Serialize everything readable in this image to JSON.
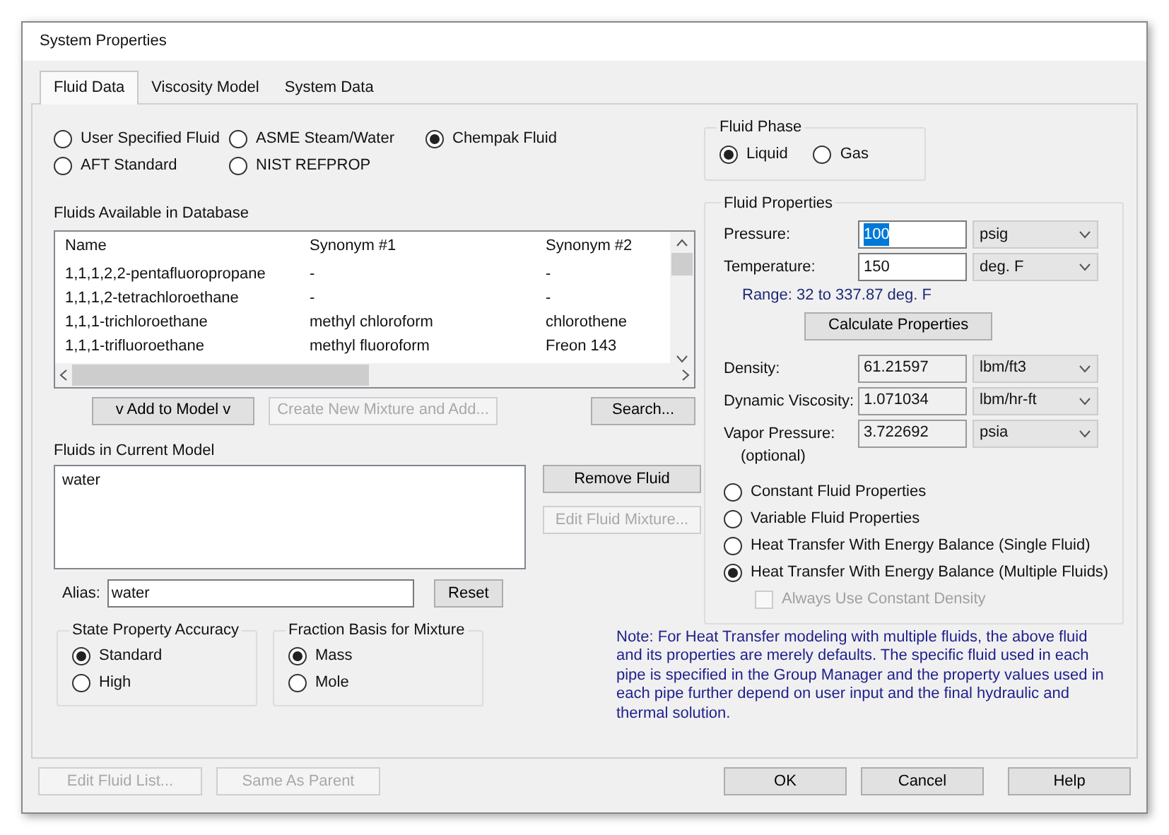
{
  "window": {
    "title": "System Properties"
  },
  "tabs": [
    {
      "label": "Fluid Data",
      "selected": true
    },
    {
      "label": "Viscosity Model",
      "selected": false
    },
    {
      "label": "System Data",
      "selected": false
    }
  ],
  "fluid_source": [
    {
      "label": "User Specified Fluid",
      "selected": false
    },
    {
      "label": "ASME Steam/Water",
      "selected": false
    },
    {
      "label": "Chempak Fluid",
      "selected": true
    },
    {
      "label": "AFT Standard",
      "selected": false
    },
    {
      "label": "NIST REFPROP",
      "selected": false
    }
  ],
  "database": {
    "label": "Fluids Available in Database",
    "columns": [
      "Name",
      "Synonym #1",
      "Synonym #2"
    ],
    "rows": [
      [
        "1,1,1,2,2-pentafluoropropane",
        "-",
        "-"
      ],
      [
        "1,1,1,2-tetrachloroethane",
        "-",
        "-"
      ],
      [
        "1,1,1-trichloroethane",
        "methyl chloroform",
        "chlorothene"
      ],
      [
        "1,1,1-trifluoroethane",
        "methyl fluoroform",
        "Freon 143"
      ]
    ]
  },
  "database_buttons": [
    {
      "label": "v  Add to Model  v",
      "disabled": false
    },
    {
      "label": "Create New Mixture and Add...",
      "disabled": true
    },
    {
      "label": "Search...",
      "disabled": false
    }
  ],
  "current_model": {
    "label": "Fluids in Current Model",
    "items": [
      "water"
    ]
  },
  "model_buttons": [
    {
      "label": "Remove Fluid",
      "disabled": false
    },
    {
      "label": "Edit Fluid Mixture...",
      "disabled": true
    }
  ],
  "alias": {
    "label": "Alias:",
    "value": "water",
    "button": "Reset"
  },
  "option_groups": [
    {
      "title": "State Property Accuracy",
      "options": [
        {
          "label": "Standard",
          "selected": true
        },
        {
          "label": "High",
          "selected": false
        }
      ]
    },
    {
      "title": "Fraction Basis for Mixture",
      "options": [
        {
          "label": "Mass",
          "selected": true
        },
        {
          "label": "Mole",
          "selected": false
        }
      ]
    }
  ],
  "fluid_phase": {
    "title": "Fluid Phase",
    "options": [
      {
        "label": "Liquid",
        "selected": true
      },
      {
        "label": "Gas",
        "selected": false
      }
    ]
  },
  "fluid_properties": {
    "title": "Fluid Properties",
    "inputs": [
      {
        "label": "Pressure:",
        "value": "100",
        "unit": "psig",
        "highlighted": true,
        "readonly": false
      },
      {
        "label": "Temperature:",
        "value": "150",
        "unit": "deg. F",
        "highlighted": false,
        "readonly": false
      }
    ],
    "range": "Range: 32 to 337.87 deg. F",
    "calculate_button": "Calculate Properties",
    "results": [
      {
        "label": "Density:",
        "value": "61.21597",
        "unit": "lbm/ft3",
        "readonly": true
      },
      {
        "label": "Dynamic Viscosity:",
        "value": "1.071034",
        "unit": "lbm/hr-ft",
        "readonly": true
      },
      {
        "label": "Vapor Pressure:",
        "sublabel": "(optional)",
        "value": "3.722692",
        "unit": "psia",
        "readonly": true
      }
    ],
    "modes": [
      {
        "label": "Constant Fluid Properties",
        "selected": false
      },
      {
        "label": "Variable Fluid Properties",
        "selected": false
      },
      {
        "label": "Heat Transfer With Energy Balance (Single Fluid)",
        "selected": false
      },
      {
        "label": "Heat Transfer With Energy Balance (Multiple Fluids)",
        "selected": true
      }
    ],
    "constant_density": {
      "label": "Always Use Constant Density",
      "checked": false,
      "disabled": true
    }
  },
  "note": "Note: For Heat Transfer modeling with multiple fluids, the above fluid and its properties are merely defaults. The specific fluid used in each pipe is specified in the Group Manager and the property values used in each pipe further depend on user input and the final hydraulic and thermal solution.",
  "footer_left": [
    {
      "label": "Edit Fluid List...",
      "disabled": true
    },
    {
      "label": "Same As Parent",
      "disabled": true
    }
  ],
  "footer_right": [
    {
      "label": "OK",
      "disabled": false
    },
    {
      "label": "Cancel",
      "disabled": false
    },
    {
      "label": "Help",
      "disabled": false
    }
  ]
}
